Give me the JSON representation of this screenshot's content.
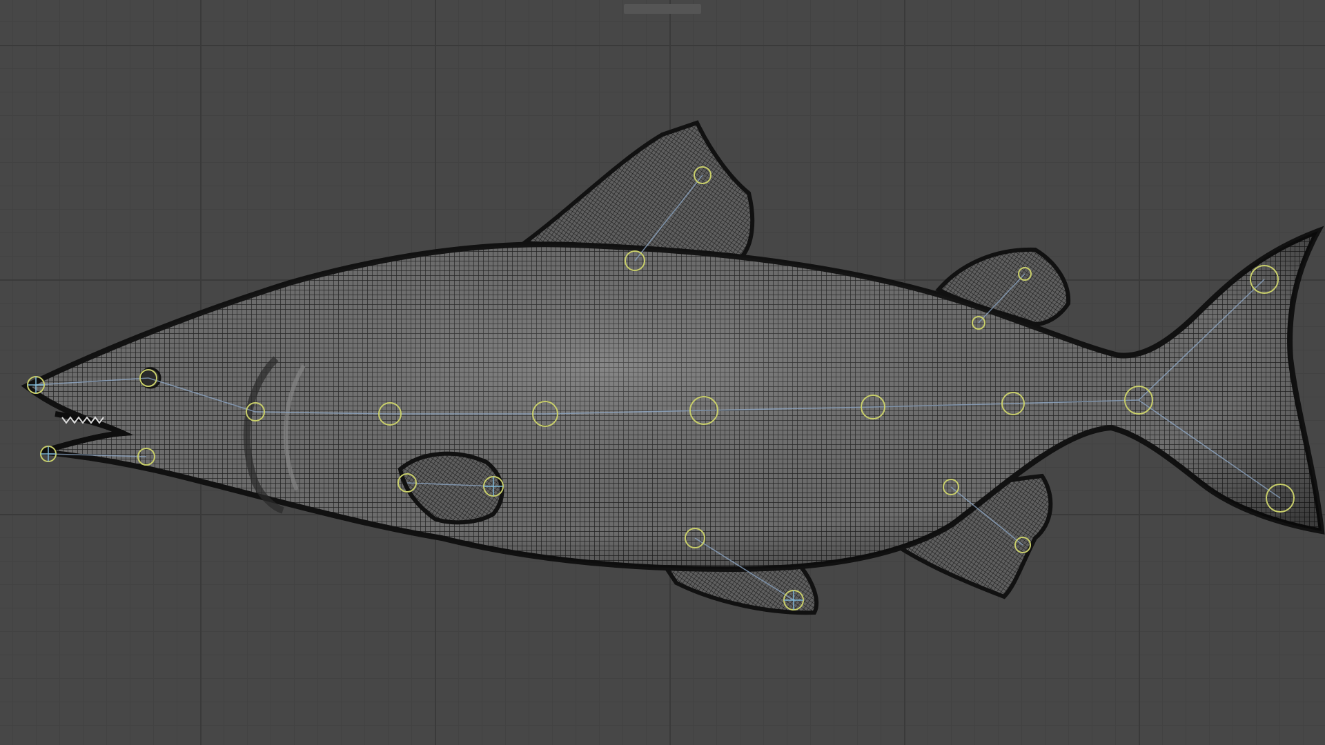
{
  "app": {
    "view": "3d-viewport"
  },
  "viewport": {
    "background_color": "#474747",
    "grid_major_color": "#3a3a3a",
    "grid_minor_color": "#424242"
  },
  "model": {
    "subject": "fish",
    "render_mode": "wireframe",
    "mesh_color": "#7a7a7a",
    "wire_color": "#1a1a1a",
    "joint_color": "#c9cf6a",
    "bone_color": "#8fa9c8"
  }
}
